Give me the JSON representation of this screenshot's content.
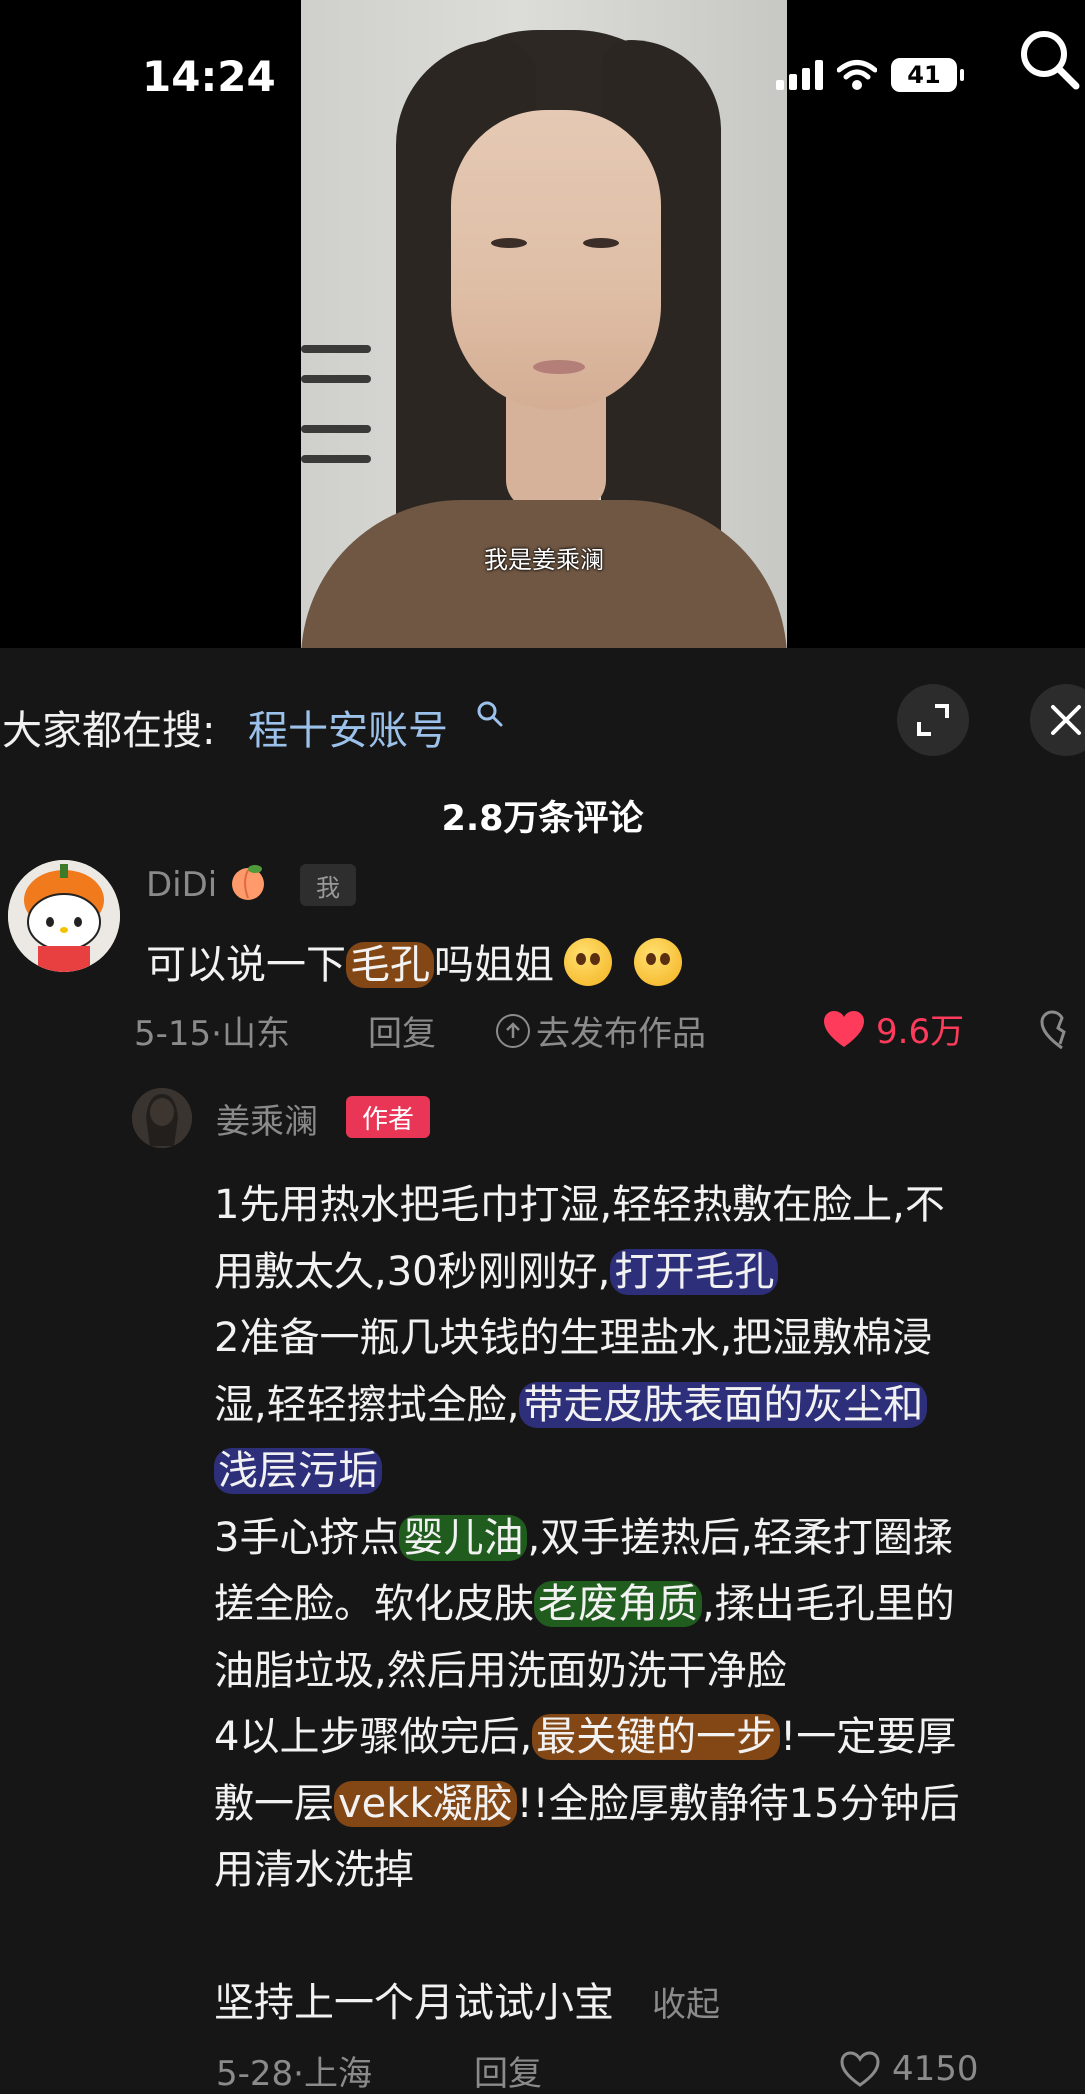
{
  "status_bar": {
    "time": "14:24",
    "battery": "41"
  },
  "video": {
    "subtitle": "我是姜乘澜"
  },
  "search_bar": {
    "prefix": "大家都在搜:",
    "term": "程十安账号"
  },
  "comments_header": {
    "count_label": "2.8万条评论"
  },
  "comment": {
    "username": "DiDi",
    "username_emoji": "peach-emoji",
    "me_badge": "我",
    "text_before": "可以说一下",
    "text_highlight": "毛孔",
    "text_after": "吗姐姐",
    "emojis": [
      "pleading-face-emoji",
      "pleading-face-emoji"
    ],
    "date_location": "5-15·山东",
    "reply_label": "回复",
    "publish_label": "去发布作品",
    "likes": "9.6万",
    "like_color": "#ff3b5c"
  },
  "reply": {
    "username": "姜乘澜",
    "author_badge": "作者",
    "badge_color": "#ea3656",
    "lines": [
      [
        {
          "t": "1先用热水把毛巾打湿,轻轻热敷在脸上,不"
        }
      ],
      [
        {
          "t": "用敷太久,30秒刚刚好,"
        },
        {
          "t": "打开毛孔",
          "hl": "blue"
        }
      ],
      [
        {
          "t": "2准备一瓶几块钱的生理盐水,把湿敷棉浸"
        }
      ],
      [
        {
          "t": "湿,轻轻擦拭全脸,"
        },
        {
          "t": "带走皮肤表面的灰尘和",
          "hl": "blue"
        }
      ],
      [
        {
          "t": "浅层污垢",
          "hl": "blue"
        }
      ],
      [
        {
          "t": "3手心挤点"
        },
        {
          "t": "婴儿油",
          "hl": "green"
        },
        {
          "t": ",双手搓热后,轻柔打圈揉"
        }
      ],
      [
        {
          "t": "搓全脸。软化皮肤"
        },
        {
          "t": "老废角质",
          "hl": "green"
        },
        {
          "t": ",揉出毛孔里的"
        }
      ],
      [
        {
          "t": "油脂垃圾,然后用洗面奶洗干净脸"
        }
      ],
      [
        {
          "t": "4以上步骤做完后,"
        },
        {
          "t": "最关键的一步",
          "hl": "orange"
        },
        {
          "t": "!一定要厚"
        }
      ],
      [
        {
          "t": "敷一层"
        },
        {
          "t": "vekk凝胶",
          "hl": "orange"
        },
        {
          "t": "!!全脸厚敷静待15分钟后"
        }
      ],
      [
        {
          "t": "用清水洗掉"
        }
      ]
    ],
    "closing": "坚持上一个月试试小宝",
    "collapse_label": "收起",
    "date_location": "5-28·上海",
    "reply_label": "回复",
    "likes_partial": "4150"
  },
  "colors": {
    "background": "#161616",
    "search_term": "#9cc1ea",
    "highlight_blue": "#31348c",
    "highlight_green": "#226820",
    "highlight_orange": "#a85816"
  }
}
